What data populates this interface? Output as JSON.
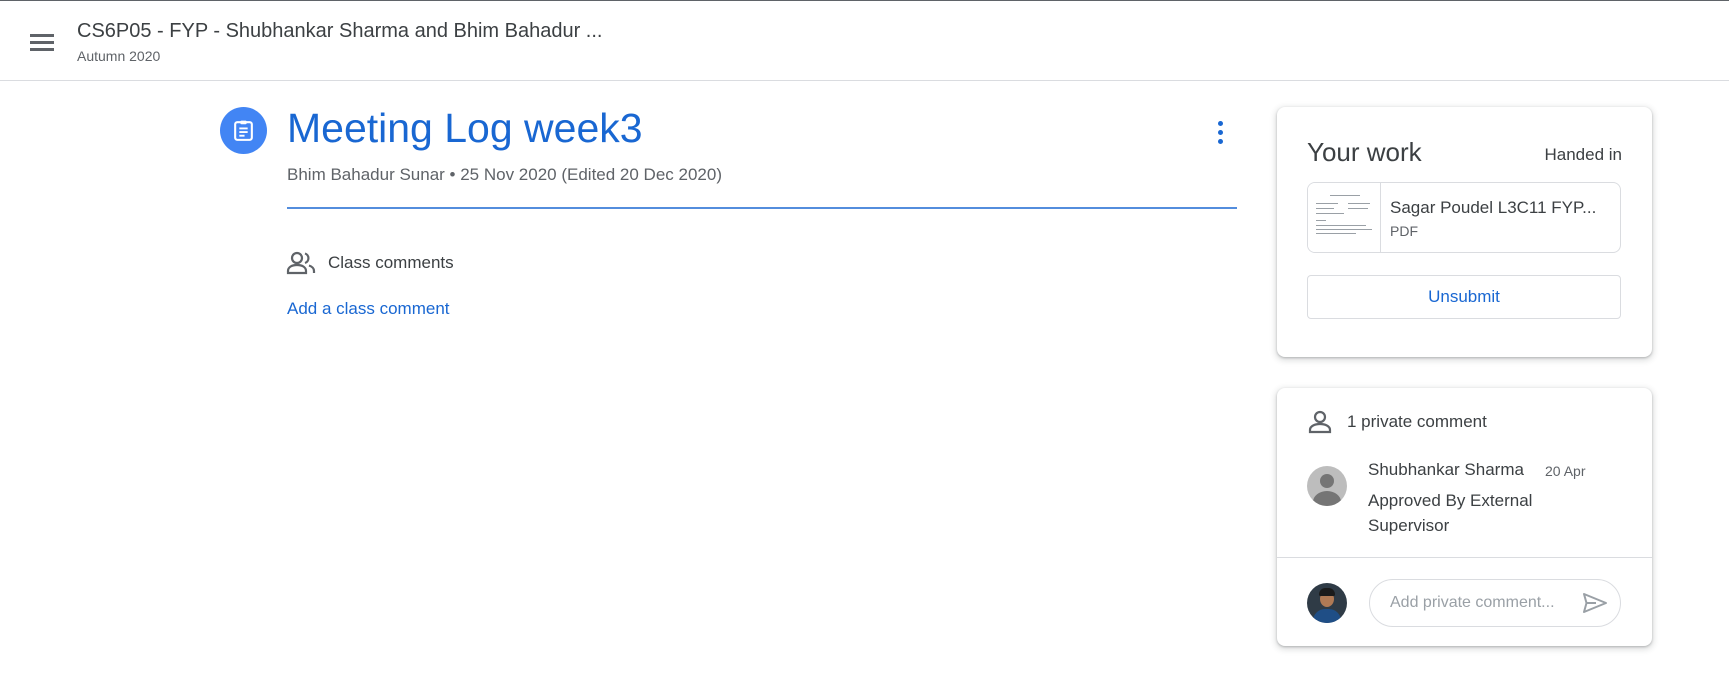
{
  "header": {
    "class_title": "CS6P05 - FYP - Shubhankar Sharma and Bhim Bahadur ...",
    "class_subtitle": "Autumn 2020"
  },
  "assignment": {
    "title": "Meeting Log week3",
    "byline": "Bhim Bahadur Sunar • 25 Nov 2020 (Edited 20 Dec 2020)",
    "class_comments_label": "Class comments",
    "add_class_comment": "Add a class comment"
  },
  "your_work": {
    "title": "Your work",
    "status": "Handed in",
    "attachment": {
      "name": "Sagar Poudel L3C11 FYP...",
      "type": "PDF"
    },
    "unsubmit_label": "Unsubmit"
  },
  "private_comments": {
    "count_label": "1 private comment",
    "comments": [
      {
        "author": "Shubhankar Sharma",
        "date": "20 Apr",
        "text": "Approved By External Supervisor"
      }
    ],
    "input_placeholder": "Add private comment..."
  },
  "colors": {
    "accent": "#1967d2",
    "icon_bg": "#4285f4",
    "text": "#3c4043",
    "muted": "#5f6368"
  }
}
